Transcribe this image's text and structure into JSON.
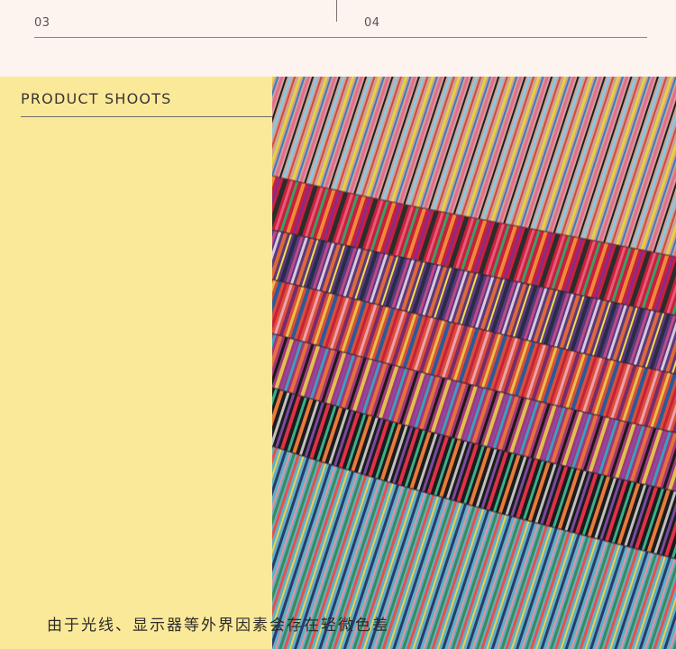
{
  "header": {
    "left_number": "03",
    "right_number": "04"
  },
  "section": {
    "title": "PRODUCT SHOOTS"
  },
  "photo": {
    "subject": "stacked striped woven fabric swatches",
    "colors": [
      "#d9a79a",
      "#c8203a",
      "#5b3a7a",
      "#e0683a",
      "#2c6fb0",
      "#1a1a1a",
      "#5fb0c6",
      "#e8d23a"
    ]
  },
  "footer": {
    "disclaimer": "由于光线、显示器等外界因素会存在轻微色差"
  },
  "colors": {
    "background": "#fdf3ef",
    "panel": "#fbe99a",
    "text": "#3a3431"
  }
}
